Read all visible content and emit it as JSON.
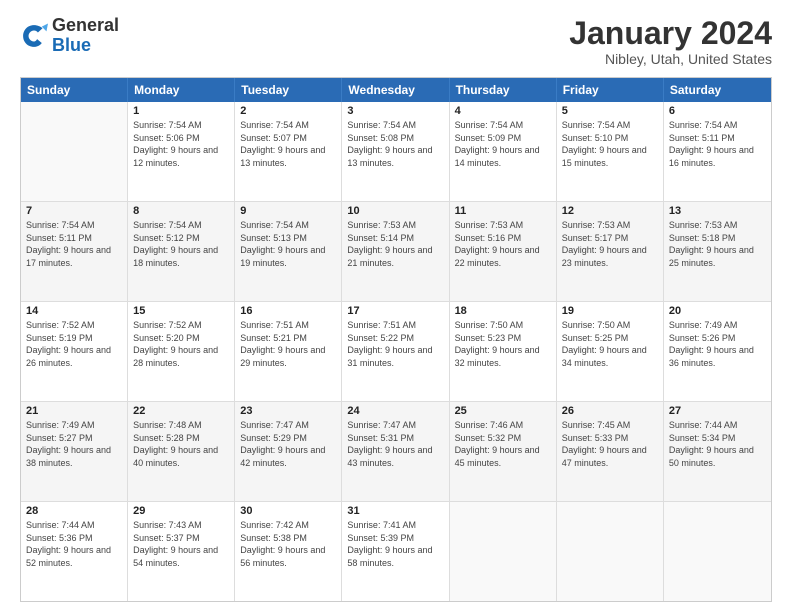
{
  "logo": {
    "text_general": "General",
    "text_blue": "Blue"
  },
  "title": "January 2024",
  "location": "Nibley, Utah, United States",
  "days_of_week": [
    "Sunday",
    "Monday",
    "Tuesday",
    "Wednesday",
    "Thursday",
    "Friday",
    "Saturday"
  ],
  "weeks": [
    [
      {
        "day": "",
        "empty": true
      },
      {
        "day": "1",
        "sunrise": "7:54 AM",
        "sunset": "5:06 PM",
        "daylight": "9 hours and 12 minutes."
      },
      {
        "day": "2",
        "sunrise": "7:54 AM",
        "sunset": "5:07 PM",
        "daylight": "9 hours and 13 minutes."
      },
      {
        "day": "3",
        "sunrise": "7:54 AM",
        "sunset": "5:08 PM",
        "daylight": "9 hours and 13 minutes."
      },
      {
        "day": "4",
        "sunrise": "7:54 AM",
        "sunset": "5:09 PM",
        "daylight": "9 hours and 14 minutes."
      },
      {
        "day": "5",
        "sunrise": "7:54 AM",
        "sunset": "5:10 PM",
        "daylight": "9 hours and 15 minutes."
      },
      {
        "day": "6",
        "sunrise": "7:54 AM",
        "sunset": "5:11 PM",
        "daylight": "9 hours and 16 minutes."
      }
    ],
    [
      {
        "day": "7",
        "sunrise": "7:54 AM",
        "sunset": "5:11 PM",
        "daylight": "9 hours and 17 minutes."
      },
      {
        "day": "8",
        "sunrise": "7:54 AM",
        "sunset": "5:12 PM",
        "daylight": "9 hours and 18 minutes."
      },
      {
        "day": "9",
        "sunrise": "7:54 AM",
        "sunset": "5:13 PM",
        "daylight": "9 hours and 19 minutes."
      },
      {
        "day": "10",
        "sunrise": "7:53 AM",
        "sunset": "5:14 PM",
        "daylight": "9 hours and 21 minutes."
      },
      {
        "day": "11",
        "sunrise": "7:53 AM",
        "sunset": "5:16 PM",
        "daylight": "9 hours and 22 minutes."
      },
      {
        "day": "12",
        "sunrise": "7:53 AM",
        "sunset": "5:17 PM",
        "daylight": "9 hours and 23 minutes."
      },
      {
        "day": "13",
        "sunrise": "7:53 AM",
        "sunset": "5:18 PM",
        "daylight": "9 hours and 25 minutes."
      }
    ],
    [
      {
        "day": "14",
        "sunrise": "7:52 AM",
        "sunset": "5:19 PM",
        "daylight": "9 hours and 26 minutes."
      },
      {
        "day": "15",
        "sunrise": "7:52 AM",
        "sunset": "5:20 PM",
        "daylight": "9 hours and 28 minutes."
      },
      {
        "day": "16",
        "sunrise": "7:51 AM",
        "sunset": "5:21 PM",
        "daylight": "9 hours and 29 minutes."
      },
      {
        "day": "17",
        "sunrise": "7:51 AM",
        "sunset": "5:22 PM",
        "daylight": "9 hours and 31 minutes."
      },
      {
        "day": "18",
        "sunrise": "7:50 AM",
        "sunset": "5:23 PM",
        "daylight": "9 hours and 32 minutes."
      },
      {
        "day": "19",
        "sunrise": "7:50 AM",
        "sunset": "5:25 PM",
        "daylight": "9 hours and 34 minutes."
      },
      {
        "day": "20",
        "sunrise": "7:49 AM",
        "sunset": "5:26 PM",
        "daylight": "9 hours and 36 minutes."
      }
    ],
    [
      {
        "day": "21",
        "sunrise": "7:49 AM",
        "sunset": "5:27 PM",
        "daylight": "9 hours and 38 minutes."
      },
      {
        "day": "22",
        "sunrise": "7:48 AM",
        "sunset": "5:28 PM",
        "daylight": "9 hours and 40 minutes."
      },
      {
        "day": "23",
        "sunrise": "7:47 AM",
        "sunset": "5:29 PM",
        "daylight": "9 hours and 42 minutes."
      },
      {
        "day": "24",
        "sunrise": "7:47 AM",
        "sunset": "5:31 PM",
        "daylight": "9 hours and 43 minutes."
      },
      {
        "day": "25",
        "sunrise": "7:46 AM",
        "sunset": "5:32 PM",
        "daylight": "9 hours and 45 minutes."
      },
      {
        "day": "26",
        "sunrise": "7:45 AM",
        "sunset": "5:33 PM",
        "daylight": "9 hours and 47 minutes."
      },
      {
        "day": "27",
        "sunrise": "7:44 AM",
        "sunset": "5:34 PM",
        "daylight": "9 hours and 50 minutes."
      }
    ],
    [
      {
        "day": "28",
        "sunrise": "7:44 AM",
        "sunset": "5:36 PM",
        "daylight": "9 hours and 52 minutes."
      },
      {
        "day": "29",
        "sunrise": "7:43 AM",
        "sunset": "5:37 PM",
        "daylight": "9 hours and 54 minutes."
      },
      {
        "day": "30",
        "sunrise": "7:42 AM",
        "sunset": "5:38 PM",
        "daylight": "9 hours and 56 minutes."
      },
      {
        "day": "31",
        "sunrise": "7:41 AM",
        "sunset": "5:39 PM",
        "daylight": "9 hours and 58 minutes."
      },
      {
        "day": "",
        "empty": true
      },
      {
        "day": "",
        "empty": true
      },
      {
        "day": "",
        "empty": true
      }
    ]
  ],
  "labels": {
    "sunrise_prefix": "Sunrise: ",
    "sunset_prefix": "Sunset: ",
    "daylight_prefix": "Daylight: "
  }
}
